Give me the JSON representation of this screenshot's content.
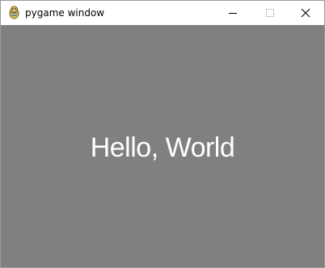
{
  "window": {
    "title": "pygame window",
    "icon": "pygame-snake-icon",
    "controls": {
      "minimize_icon": "minimize-icon",
      "maximize_icon": "maximize-icon",
      "close_icon": "close-icon"
    }
  },
  "canvas": {
    "text": "Hello, World",
    "background_color": "#808080",
    "text_color": "#ffffff"
  }
}
